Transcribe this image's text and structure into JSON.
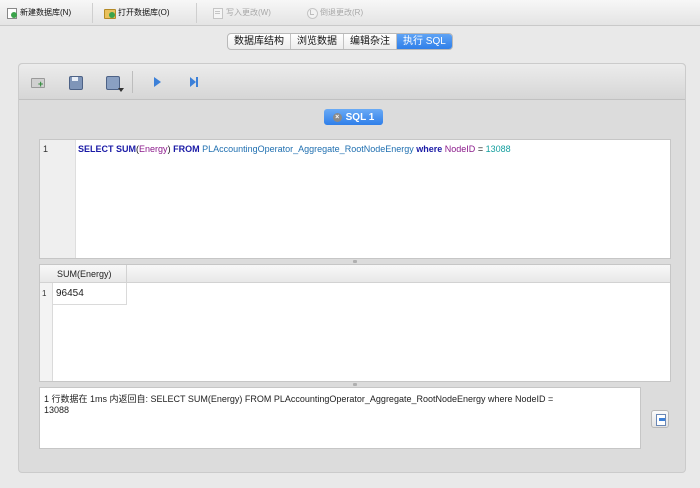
{
  "toolbar": {
    "new_db": "新建数据库(N)",
    "open_db": "打开数据库(O)",
    "write_changes": "写入更改(W)",
    "revert_changes": "倒退更改(R)"
  },
  "tabs": [
    {
      "label": "数据库结构",
      "active": false
    },
    {
      "label": "浏览数据",
      "active": false
    },
    {
      "label": "编辑杂注",
      "active": false
    },
    {
      "label": "执行 SQL",
      "active": true
    }
  ],
  "sql_tab": {
    "label": "SQL 1"
  },
  "editor": {
    "line_number": "1",
    "tokens": {
      "select": "SELECT",
      "sum": "SUM",
      "open_paren": "(",
      "column": "Energy",
      "close_paren": ")",
      "from": "FROM",
      "table": "PLAccountingOperator_Aggregate_RootNodeEnergy",
      "where": "where",
      "field": "NodeID",
      "equals": "=",
      "value": "13088"
    }
  },
  "results": {
    "column": "SUM(Energy)",
    "row_number": "1",
    "value": "96454"
  },
  "message": {
    "line1": "1 行数据在 1ms 内返回自: SELECT SUM(Energy) FROM PLAccountingOperator_Aggregate_RootNodeEnergy where NodeID =",
    "line2": "13088"
  },
  "colors": {
    "accent": "#2f7fe9",
    "keyword": "#1a1aa6",
    "function": "#8b1a8b",
    "table": "#1f6fb0",
    "number": "#149f9f"
  }
}
